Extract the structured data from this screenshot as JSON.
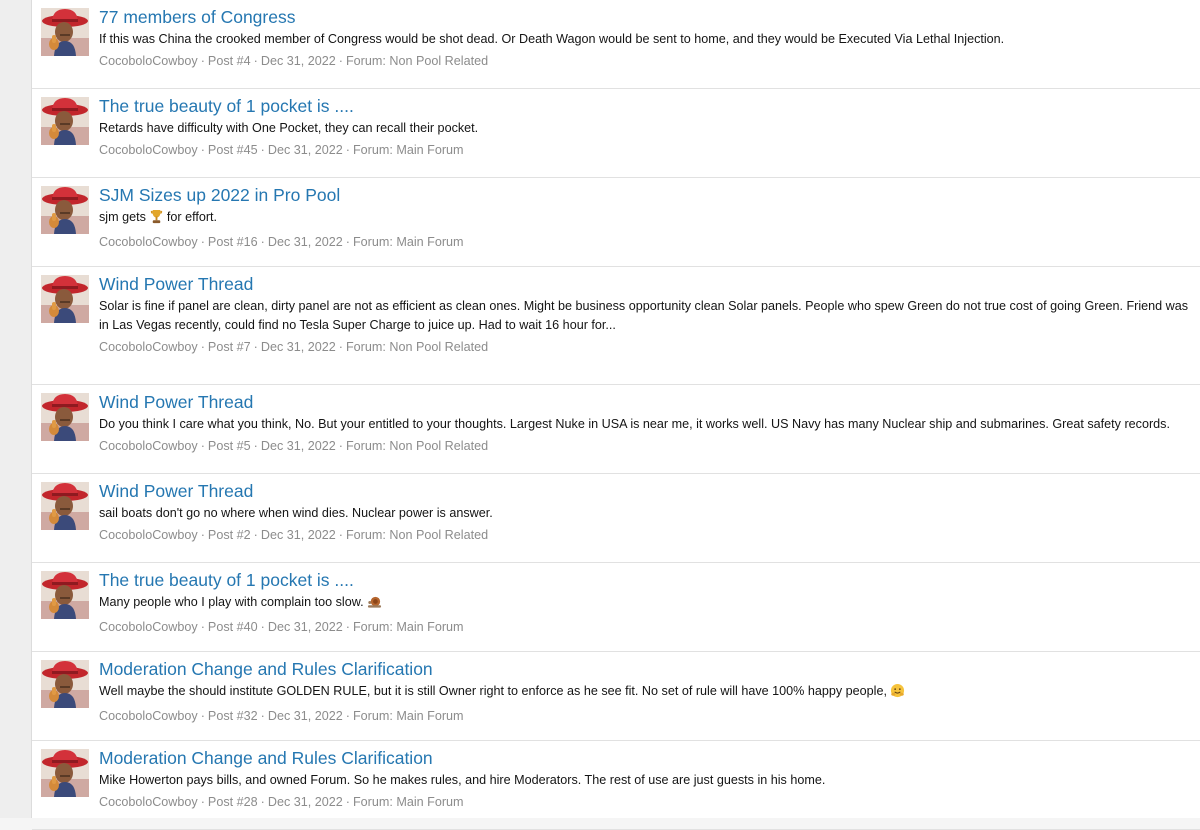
{
  "results": [
    {
      "title": "77 members of Congress",
      "snippet": "If this was China the crooked member of Congress would be shot dead. Or Death Wagon would be sent to home, and they would be Executed Via Lethal Injection.",
      "author": "CocoboloCowboy",
      "post": "Post #4",
      "date": "Dec 31, 2022",
      "forum_prefix": "Forum:",
      "forum": "Non Pool Related"
    },
    {
      "title": "The true beauty of 1 pocket is ....",
      "snippet": "Retards have difficulty with One Pocket, they can recall their pocket.",
      "author": "CocoboloCowboy",
      "post": "Post #45",
      "date": "Dec 31, 2022",
      "forum_prefix": "Forum:",
      "forum": "Main Forum"
    },
    {
      "title": "SJM Sizes up 2022 in Pro Pool",
      "snippet_before": "sjm gets",
      "snippet_after": "for effort.",
      "emoji": "trophy-icon",
      "author": "CocoboloCowboy",
      "post": "Post #16",
      "date": "Dec 31, 2022",
      "forum_prefix": "Forum:",
      "forum": "Main Forum"
    },
    {
      "title": "Wind Power Thread",
      "snippet": "Solar is fine if panel are clean, dirty panel are not as efficient as clean ones. Might be business opportunity clean Solar panels. People who spew Green do not true cost of going Green. Friend was in Las Vegas recently, could find no Tesla Super Charge to juice up. Had to wait 16 hour for...",
      "author": "CocoboloCowboy",
      "post": "Post #7",
      "date": "Dec 31, 2022",
      "forum_prefix": "Forum:",
      "forum": "Non Pool Related"
    },
    {
      "title": "Wind Power Thread",
      "snippet": "Do you think I care what you think, No. But your entitled to your thoughts. Largest Nuke in USA is near me, it works well. US Navy has many Nuclear ship and submarines. Great safety records.",
      "author": "CocoboloCowboy",
      "post": "Post #5",
      "date": "Dec 31, 2022",
      "forum_prefix": "Forum:",
      "forum": "Non Pool Related"
    },
    {
      "title": "Wind Power Thread",
      "snippet": "sail boats don't go no where when wind dies. Nuclear power is answer.",
      "author": "CocoboloCowboy",
      "post": "Post #2",
      "date": "Dec 31, 2022",
      "forum_prefix": "Forum:",
      "forum": "Non Pool Related"
    },
    {
      "title": "The true beauty of 1 pocket is ....",
      "snippet_before": "Many people who I play with complain too slow.",
      "snippet_after": "",
      "emoji": "snail-icon",
      "author": "CocoboloCowboy",
      "post": "Post #40",
      "date": "Dec 31, 2022",
      "forum_prefix": "Forum:",
      "forum": "Main Forum"
    },
    {
      "title": "Moderation Change and Rules Clarification",
      "snippet_before": "Well maybe the should institute GOLDEN RULE, but it is still Owner right to enforce as he see fit. No set of rule will have 100% happy people,",
      "snippet_after": "",
      "emoji": "hugging-face-icon",
      "author": "CocoboloCowboy",
      "post": "Post #32",
      "date": "Dec 31, 2022",
      "forum_prefix": "Forum:",
      "forum": "Main Forum"
    },
    {
      "title": "Moderation Change and Rules Clarification",
      "snippet": "Mike Howerton pays bills, and owned Forum. So he makes rules, and hire Moderators. The rest of use are just guests in his home.",
      "author": "CocoboloCowboy",
      "post": "Post #28",
      "date": "Dec 31, 2022",
      "forum_prefix": "Forum:",
      "forum": "Main Forum"
    }
  ],
  "meta_separator": "·",
  "colors": {
    "title_link": "#2577b1",
    "meta_text": "#8c8c8c",
    "row_border": "#e1e1e1",
    "gutter": "#eeeeee"
  }
}
